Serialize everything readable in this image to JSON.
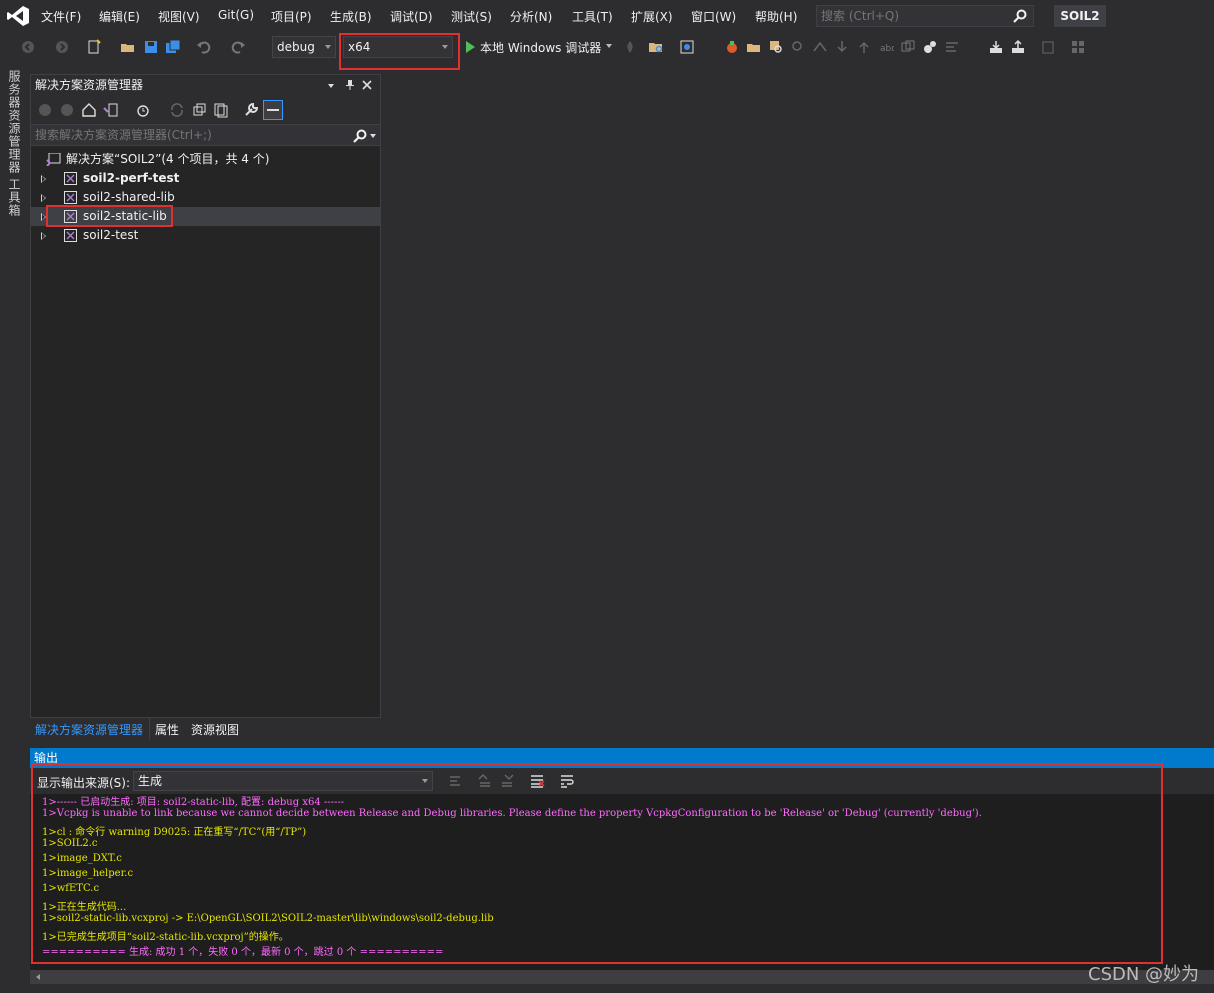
{
  "menubar": {
    "items": [
      "文件(F)",
      "编辑(E)",
      "视图(V)",
      "Git(G)",
      "项目(P)",
      "生成(B)",
      "调试(D)",
      "测试(S)",
      "分析(N)",
      "工具(T)",
      "扩展(X)",
      "窗口(W)",
      "帮助(H)"
    ],
    "search_placeholder": "搜索 (Ctrl+Q)",
    "solution_name": "SOIL2"
  },
  "toolbar": {
    "config": "debug",
    "platform": "x64",
    "run_label": "本地 Windows 调试器"
  },
  "vertical_tabs": [
    "服务器资源管理器",
    "工具箱"
  ],
  "solution_explorer": {
    "title": "解决方案资源管理器",
    "search_placeholder": "搜索解决方案资源管理器(Ctrl+;)",
    "solution_label": "解决方案“SOIL2”(4 个项目，共 4 个)",
    "projects": [
      {
        "name": "soil2-perf-test",
        "bold": true
      },
      {
        "name": "soil2-shared-lib",
        "bold": false
      },
      {
        "name": "soil2-static-lib",
        "bold": false
      },
      {
        "name": "soil2-test",
        "bold": false
      }
    ],
    "tabs": [
      "解决方案资源管理器",
      "属性",
      "资源视图"
    ]
  },
  "output": {
    "title": "输出",
    "source_label": "显示输出来源(S):",
    "source_value": "生成",
    "lines": [
      {
        "text": "1>------ 已启动生成: 项目: soil2-static-lib, 配置: debug x64 ------",
        "color": "magenta"
      },
      {
        "text": "1>Vcpkg is unable to link because we cannot decide between Release and Debug libraries. Please define the property VcpkgConfiguration to be 'Release' or 'Debug' (currently 'debug').",
        "color": "magenta"
      },
      {
        "text": "1>cl : 命令行 warning D9025: 正在重写“/TC”(用“/TP”)",
        "color": "yellow"
      },
      {
        "text": "1>SOIL2.c",
        "color": "yellow"
      },
      {
        "text": "1>image_DXT.c",
        "color": "yellow"
      },
      {
        "text": "1>image_helper.c",
        "color": "yellow"
      },
      {
        "text": "1>wfETC.c",
        "color": "yellow"
      },
      {
        "text": "1>正在生成代码...",
        "color": "yellow"
      },
      {
        "text": "1>soil2-static-lib.vcxproj -> E:\\OpenGL\\SOIL2\\SOIL2-master\\lib\\windows\\soil2-debug.lib",
        "color": "yellow"
      },
      {
        "text": "1>已完成生成项目“soil2-static-lib.vcxproj”的操作。",
        "color": "yellow"
      },
      {
        "text": "========== 生成: 成功 1 个，失败 0 个，最新 0 个，跳过 0 个 ==========",
        "color": "magenta"
      }
    ]
  },
  "watermark": "CSDN @妙为",
  "colors": {
    "accent": "#007acc",
    "highlight_box": "#e03131",
    "output_yellow": "#e6e600",
    "output_magenta": "#ff6bff"
  }
}
